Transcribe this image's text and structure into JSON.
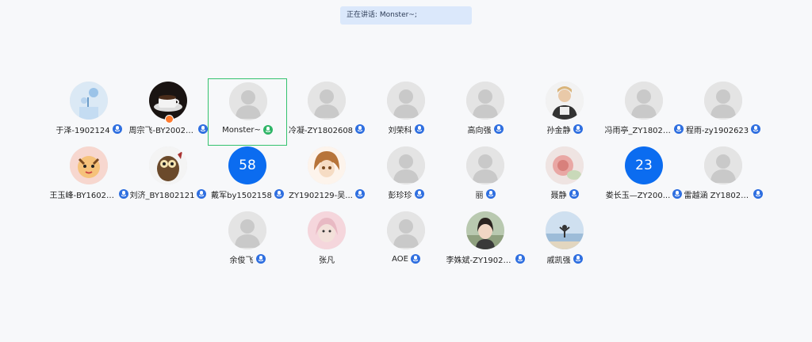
{
  "banner": {
    "text": "正在讲话: Monster~;"
  },
  "participants": [
    {
      "name": "于泽-1902124",
      "avatar": "photo-flowers",
      "mic": "blue"
    },
    {
      "name": "周宗飞-BY20021...",
      "avatar": "photo-coffee",
      "mic": "blue",
      "badge": true
    },
    {
      "name": "Monster~",
      "avatar": "default",
      "mic": "green",
      "active": true
    },
    {
      "name": "冷凝-ZY1802608",
      "avatar": "default",
      "mic": "blue"
    },
    {
      "name": "刘荣科",
      "avatar": "default",
      "mic": "blue"
    },
    {
      "name": "高向强",
      "avatar": "default",
      "mic": "blue"
    },
    {
      "name": "孙金静",
      "avatar": "photo-person-white",
      "mic": "blue"
    },
    {
      "name": "冯雨亭_ZY18021...",
      "avatar": "default",
      "mic": "blue"
    },
    {
      "name": "程雨-zy1902623",
      "avatar": "default",
      "mic": "blue"
    },
    {
      "name": "王玉峰-BY16021...",
      "avatar": "photo-cartoon-tiger",
      "mic": "blue"
    },
    {
      "name": "刘济_BY1802121",
      "avatar": "photo-owl",
      "mic": "blue"
    },
    {
      "name": "戴军by1502158",
      "avatar": "number",
      "number": "58",
      "mic": "blue"
    },
    {
      "name": "ZY1902129-吴...",
      "avatar": "photo-anime",
      "mic": "blue"
    },
    {
      "name": "彭珍珍",
      "avatar": "default",
      "mic": "blue"
    },
    {
      "name": "丽",
      "avatar": "default",
      "mic": "blue"
    },
    {
      "name": "聂静",
      "avatar": "photo-flower-pink",
      "mic": "blue"
    },
    {
      "name": "娄长玉—ZY200...",
      "avatar": "number",
      "number": "23",
      "mic": "blue"
    },
    {
      "name": "雷越涵 ZY18021...",
      "avatar": "default",
      "mic": "blue"
    },
    {
      "name": "余俊飞",
      "avatar": "default",
      "mic": "blue"
    },
    {
      "name": "张凡",
      "avatar": "photo-pink-girl",
      "mic": "none"
    },
    {
      "name": "AOE",
      "avatar": "default",
      "mic": "blue"
    },
    {
      "name": "李姝斌-ZY19021...",
      "avatar": "photo-girl-outdoor",
      "mic": "blue"
    },
    {
      "name": "戚凯强",
      "avatar": "photo-beach",
      "mic": "blue"
    }
  ],
  "colors": {
    "accent": "#2f6fe0",
    "active_border": "#34c26e",
    "speaking_mic": "#2fb567",
    "number_avatar": "#0b6cf0"
  }
}
